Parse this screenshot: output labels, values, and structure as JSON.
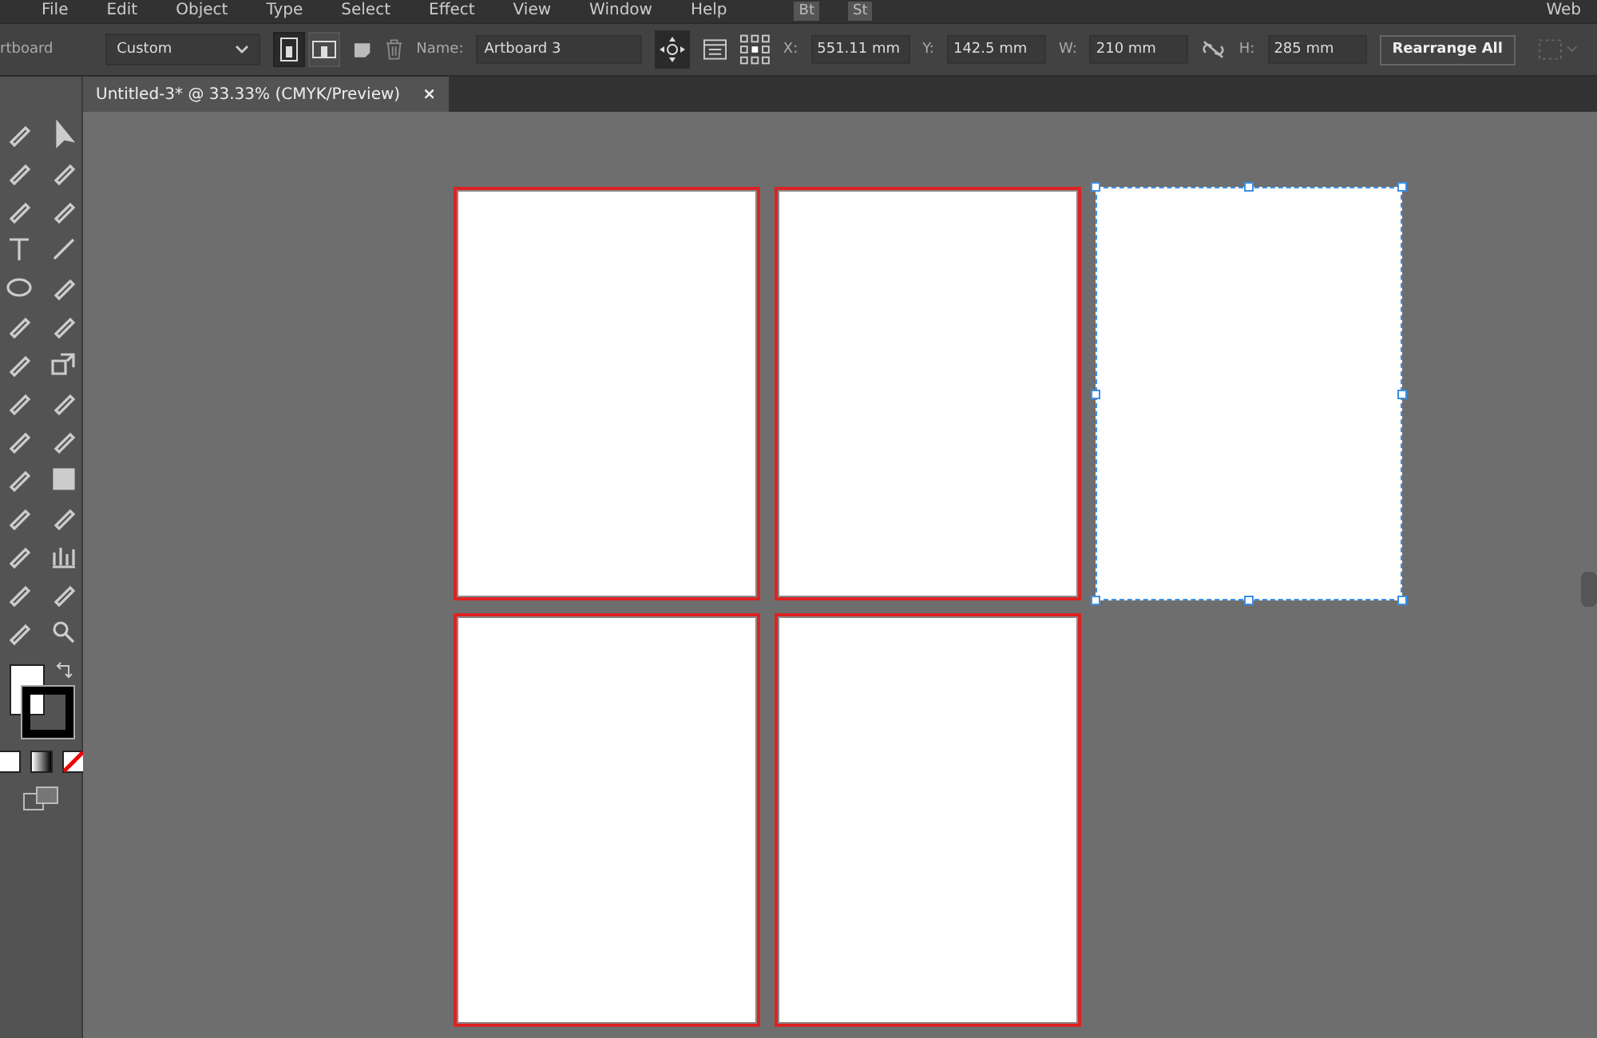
{
  "menu_bar": {
    "items": [
      "File",
      "Edit",
      "Object",
      "Type",
      "Select",
      "Effect",
      "View",
      "Window",
      "Help"
    ],
    "badges": [
      "Bt",
      "St"
    ],
    "workspace": "Web"
  },
  "control_bar": {
    "tool_label": "rtboard",
    "preset": "Custom",
    "orientations": [
      {
        "kind": "portrait",
        "selected": true
      },
      {
        "kind": "landscape",
        "selected": false
      }
    ],
    "name_label": "Name:",
    "name": "Artboard 3",
    "fields": [
      {
        "label": "X:",
        "value": "551.11 mm"
      },
      {
        "label": "Y:",
        "value": "142.5 mm"
      },
      {
        "label": "W:",
        "value": "210 mm"
      },
      {
        "label": "H:",
        "value": "285 mm"
      }
    ],
    "rearrange_button": "Rearrange All"
  },
  "document_tab": {
    "title": "Untitled-3* @ 33.33% (CMYK/Preview)",
    "close": "×"
  },
  "artboards": [
    {
      "selected": false
    },
    {
      "selected": false
    },
    {
      "selected": true
    },
    {
      "selected": false
    },
    {
      "selected": false
    }
  ]
}
